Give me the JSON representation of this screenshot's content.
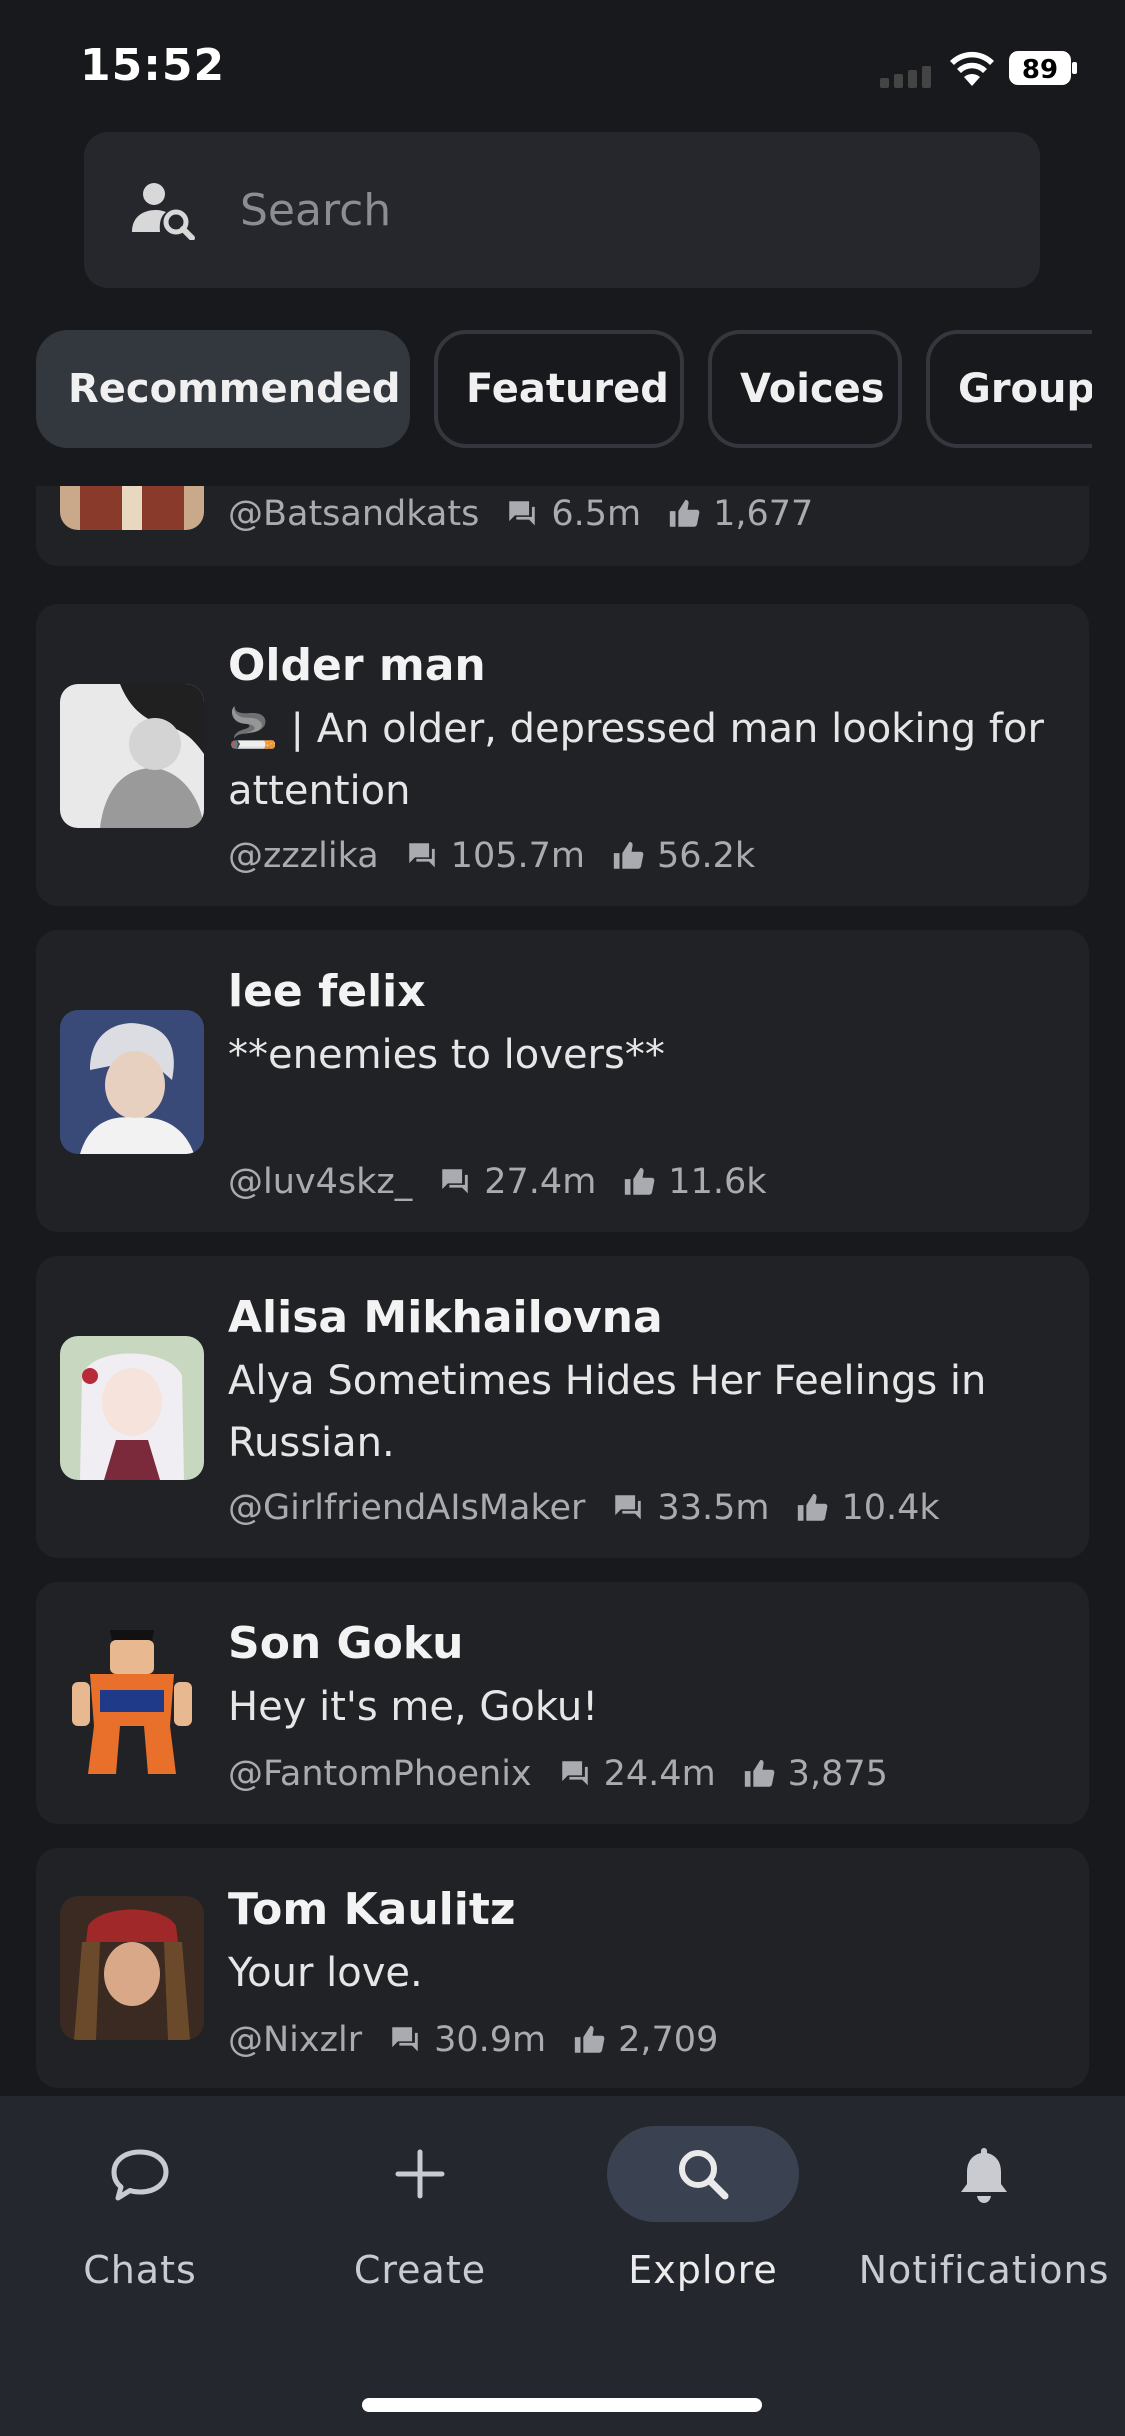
{
  "status_bar": {
    "time": "15:52",
    "battery": "89"
  },
  "search": {
    "placeholder": "Search"
  },
  "tabs": [
    {
      "label": "Recommended",
      "active": true
    },
    {
      "label": "Featured",
      "active": false
    },
    {
      "label": "Voices",
      "active": false
    },
    {
      "label": "Groups",
      "active": false
    }
  ],
  "characters": [
    {
      "name": "",
      "description": "",
      "creator": "@Batsandkats",
      "chats": "6.5m",
      "likes": "1,677"
    },
    {
      "name": "Older man",
      "description": "🚬 | An older, depressed man looking for attention",
      "creator": "@zzzlika",
      "chats": "105.7m",
      "likes": "56.2k"
    },
    {
      "name": "lee felix",
      "description": "**enemies to lovers**",
      "creator": "@luv4skz_",
      "chats": "27.4m",
      "likes": "11.6k"
    },
    {
      "name": "Alisa Mikhailovna",
      "description": "Alya Sometimes Hides Her Feelings in Russian.",
      "creator": "@GirlfriendAIsMaker",
      "chats": "33.5m",
      "likes": "10.4k"
    },
    {
      "name": "Son Goku",
      "description": "Hey it's me, Goku!",
      "creator": "@FantomPhoenix",
      "chats": "24.4m",
      "likes": "3,875"
    },
    {
      "name": "Tom Kaulitz",
      "description": "Your love.",
      "creator": "@Nixzlr",
      "chats": "30.9m",
      "likes": "2,709"
    }
  ],
  "bottom_nav": [
    {
      "label": "Chats",
      "icon": "chat-bubble-icon",
      "active": false
    },
    {
      "label": "Create",
      "icon": "plus-icon",
      "active": false
    },
    {
      "label": "Explore",
      "icon": "search-icon",
      "active": true
    },
    {
      "label": "Notifications",
      "icon": "bell-icon",
      "active": false
    }
  ],
  "colors": {
    "background": "#18191c",
    "card": "#202226",
    "active_tab": "#33373e",
    "active_nav": "#3a4150",
    "muted_text": "#a9abb0"
  }
}
